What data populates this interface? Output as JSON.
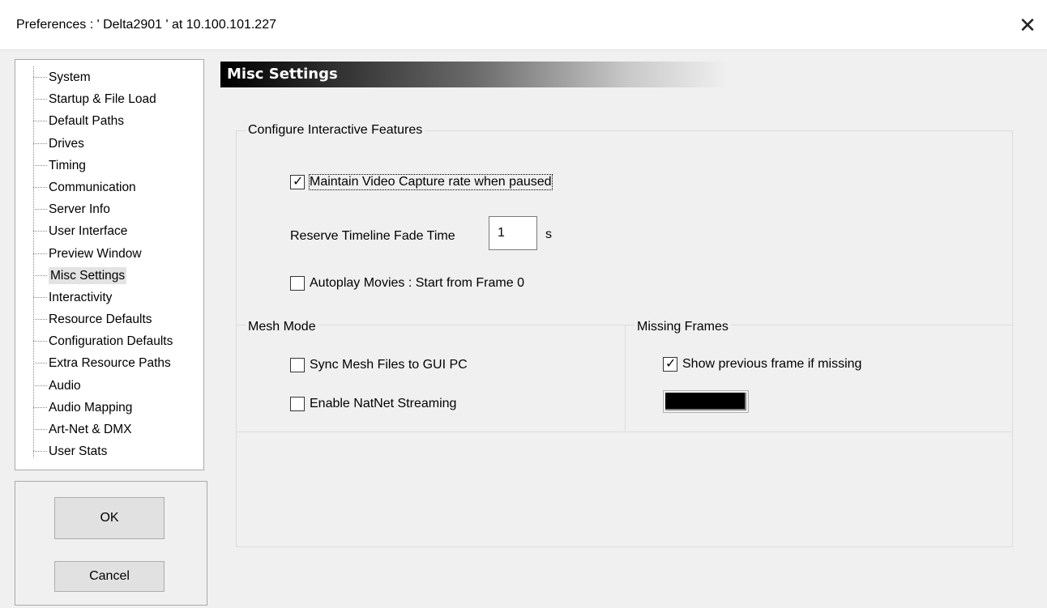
{
  "window": {
    "title": "Preferences  :  ' Delta2901 '  at  10.100.101.227",
    "close_glyph": "✕"
  },
  "sidebar": {
    "items": [
      {
        "label": "System"
      },
      {
        "label": "Startup & File Load"
      },
      {
        "label": "Default Paths"
      },
      {
        "label": "Drives"
      },
      {
        "label": "Timing"
      },
      {
        "label": "Communication"
      },
      {
        "label": "Server Info"
      },
      {
        "label": "User Interface"
      },
      {
        "label": "Preview Window"
      },
      {
        "label": "Misc Settings",
        "selected": true
      },
      {
        "label": "Interactivity"
      },
      {
        "label": "Resource Defaults"
      },
      {
        "label": "Configuration Defaults"
      },
      {
        "label": "Extra Resource Paths"
      },
      {
        "label": "Audio"
      },
      {
        "label": "Audio Mapping"
      },
      {
        "label": "Art-Net & DMX"
      },
      {
        "label": "User Stats"
      }
    ]
  },
  "buttons": {
    "ok": "OK",
    "cancel": "Cancel"
  },
  "panel": {
    "header": "Misc Settings",
    "interactive": {
      "label": "Configure Interactive Features",
      "maintain_video": {
        "label": "Maintain Video Capture rate when paused",
        "checked": true
      },
      "fade_time": {
        "label": "Reserve Timeline Fade Time",
        "value": "1",
        "unit": "s"
      },
      "autoplay": {
        "label": "Autoplay Movies : Start from Frame 0",
        "checked": false
      }
    },
    "mesh_mode": {
      "label": "Mesh Mode",
      "sync_mesh": {
        "label": "Sync Mesh Files to GUI PC",
        "checked": false
      },
      "natnet": {
        "label": "Enable NatNet Streaming",
        "checked": false
      }
    },
    "missing_frames": {
      "label": "Missing Frames",
      "show_previous": {
        "label": "Show previous frame if missing",
        "checked": true
      },
      "color": "#000000"
    }
  },
  "check_glyph": "✓"
}
